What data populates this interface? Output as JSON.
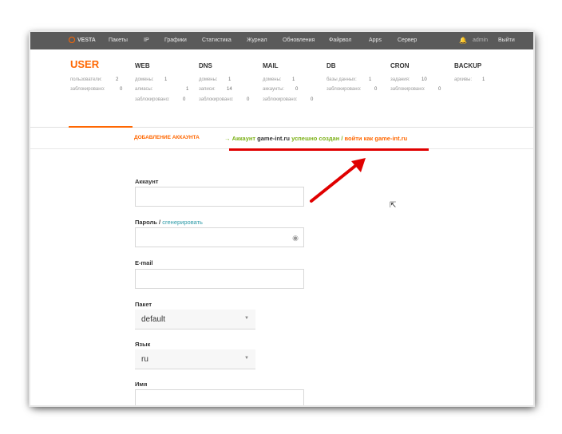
{
  "topnav": {
    "logo": "VESTA",
    "items": [
      "Пакеты",
      "IP",
      "Графики",
      "Статистика",
      "Журнал",
      "Обновления",
      "Файрвол",
      "Apps",
      "Сервер"
    ],
    "user": "admin",
    "logout": "Выйти"
  },
  "stats": {
    "user": {
      "title": "USER",
      "rows": [
        {
          "label": "пользователи:",
          "value": "2"
        },
        {
          "label": "заблокировано:",
          "value": "0"
        }
      ]
    },
    "web": {
      "title": "WEB",
      "rows": [
        {
          "label": "домены:",
          "value": "1"
        },
        {
          "label": "алиасы:",
          "value": "1"
        },
        {
          "label": "заблокировано:",
          "value": "0"
        }
      ]
    },
    "dns": {
      "title": "DNS",
      "rows": [
        {
          "label": "домены:",
          "value": "1"
        },
        {
          "label": "записи:",
          "value": "14"
        },
        {
          "label": "заблокировано:",
          "value": "0"
        }
      ]
    },
    "mail": {
      "title": "MAIL",
      "rows": [
        {
          "label": "домены:",
          "value": "1"
        },
        {
          "label": "аккаунты:",
          "value": "0"
        },
        {
          "label": "заблокировано:",
          "value": "0"
        }
      ]
    },
    "db": {
      "title": "DB",
      "rows": [
        {
          "label": "базы данных:",
          "value": "1"
        },
        {
          "label": "заблокировано:",
          "value": "0"
        }
      ]
    },
    "cron": {
      "title": "CRON",
      "rows": [
        {
          "label": "задания:",
          "value": "10"
        },
        {
          "label": "заблокировано:",
          "value": "0"
        }
      ]
    },
    "backup": {
      "title": "BACKUP",
      "rows": [
        {
          "label": "архивы:",
          "value": "1"
        }
      ]
    }
  },
  "page": {
    "tab": "ДОБАВЛЕНИЕ АККАУНТА",
    "message": {
      "arrow": "→",
      "part1": "Аккаунт",
      "account": "game-int.ru",
      "part2": "успешно создан /",
      "login": "войти как game-int.ru"
    }
  },
  "form": {
    "account_label": "Аккаунт",
    "account_value": "",
    "password_label": "Пароль /",
    "password_generate": "сгенерировать",
    "password_value": "",
    "email_label": "E-mail",
    "email_value": "",
    "package_label": "Пакет",
    "package_value": "default",
    "language_label": "Язык",
    "language_value": "ru",
    "name_label": "Имя"
  },
  "colors": {
    "accent": "#ff6701",
    "success": "#7bb016",
    "annotation": "#e00000",
    "nav": "#5a5a5a"
  }
}
